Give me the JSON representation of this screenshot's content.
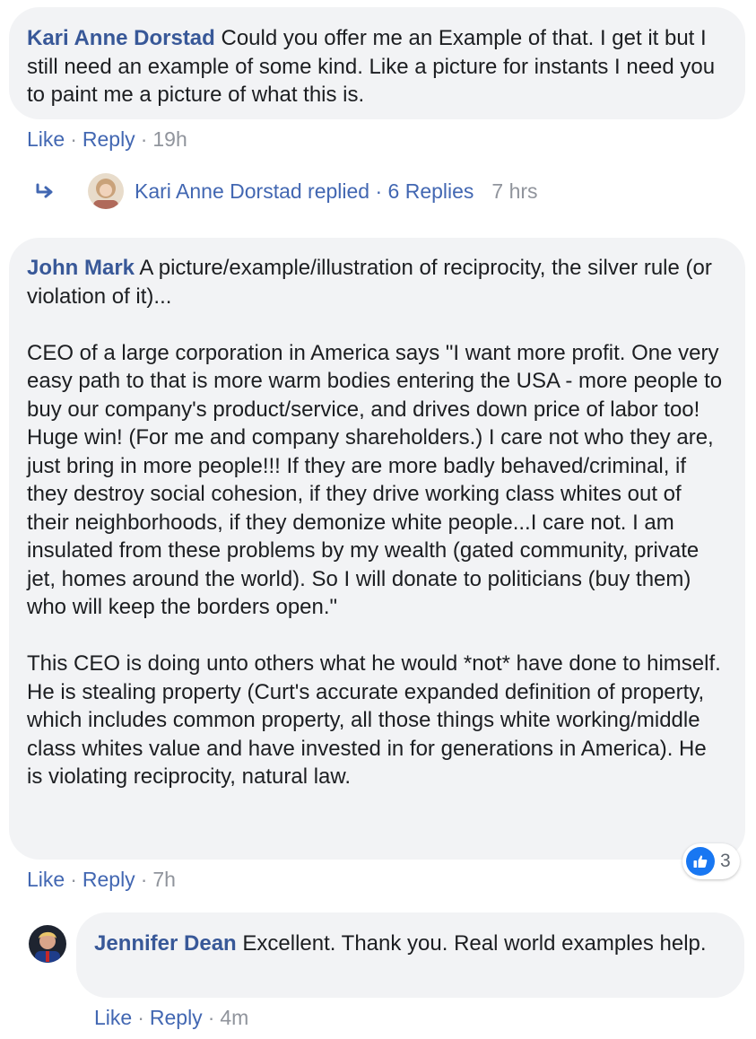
{
  "comments": [
    {
      "author": "Kari Anne Dorstad",
      "text": "Could you offer me an Example of that. I get it but I still need an example of some kind. Like a picture for instants I need you to paint me a picture of what this is.",
      "like": "Like",
      "reply": "Reply",
      "time": "19h"
    },
    {
      "author": "John Mark",
      "text": "A picture/example/illustration of reciprocity, the silver rule (or violation of it)...",
      "paragraph2": "CEO of a large corporation in America says \"I want more profit. One very easy path to that is more warm bodies entering the USA - more people to buy our company's product/service, and drives down price of labor too! Huge win! (For me and company shareholders.) I care not who they are, just bring in more people!!! If they are more badly behaved/criminal, if they destroy social cohesion, if they drive working class whites out of their neighborhoods, if they demonize white people...I care not. I am insulated from these problems by my wealth (gated community, private jet, homes around the world). So I will donate to politicians (buy them) who will keep the borders open.\"",
      "paragraph3": "This CEO is doing unto others what he would *not* have done to himself. He is stealing property (Curt's accurate expanded definition of property, which includes common property, all those things white working/middle class whites value and have invested in for generations in America). He is violating reciprocity, natural law.",
      "like": "Like",
      "reply": "Reply",
      "time": "7h",
      "reaction_count": "3"
    },
    {
      "author": "Jennifer Dean",
      "text": "Excellent. Thank you. Real world examples help.",
      "like": "Like",
      "reply": "Reply",
      "time": "4m"
    }
  ],
  "replies_summary": {
    "label": "Kari Anne Dorstad replied · 6 Replies",
    "time": "7 hrs"
  },
  "icons": {
    "reply_arrow": "reply-arrow-icon",
    "like_reaction": "thumbs-up-icon"
  },
  "colors": {
    "link": "#4267b2",
    "author": "#385898",
    "bubble": "#f2f3f5",
    "meta": "#90949c",
    "like_badge": "#1877f2"
  }
}
